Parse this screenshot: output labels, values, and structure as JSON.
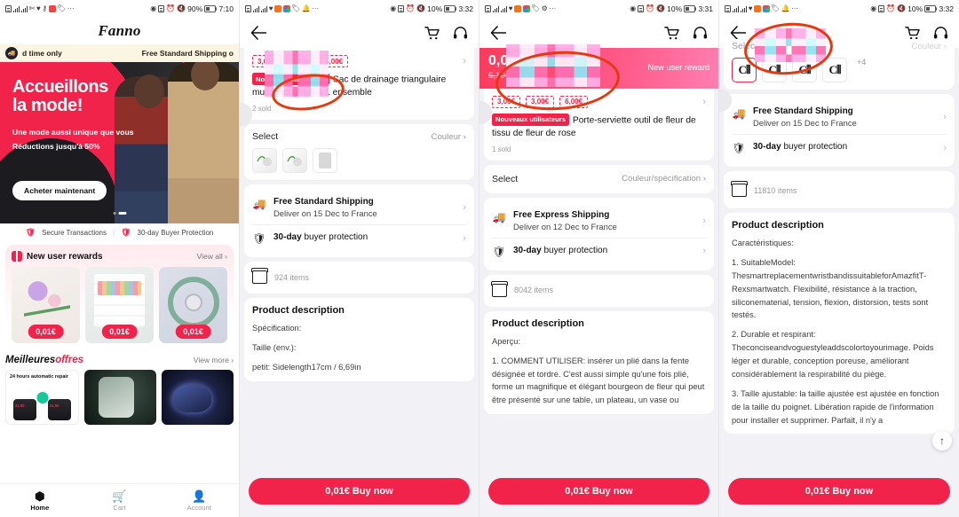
{
  "panel1": {
    "status": {
      "battery": "90%",
      "time": "7:10"
    },
    "brand": "Fanno",
    "promo": {
      "left": "d time only",
      "right": "Free Standard Shipping o"
    },
    "hero": {
      "title_line1": "Accueillons",
      "title_line2": "la mode!",
      "sub1": "Une mode aussi unique que vous",
      "sub2": "Réductions jusqu'à 50%",
      "cta": "Acheter maintenant"
    },
    "trust": {
      "left": "Secure Transactions",
      "divider": "|",
      "right": "30-day Buyer Protection"
    },
    "rewards": {
      "title": "New user rewards",
      "view_all": "View all",
      "cards": [
        {
          "price": "0,01€"
        },
        {
          "price": "0,01€"
        },
        {
          "price": "0,01€"
        }
      ]
    },
    "offers": {
      "title_black": "Meilleures",
      "title_red": "offres",
      "view_more": "View more",
      "card1_title": "24 hours automatic repair"
    },
    "tabs": [
      {
        "label": "Home",
        "icon": "home-icon"
      },
      {
        "label": "Cart",
        "icon": "cart-icon"
      },
      {
        "label": "Account",
        "icon": "account-icon"
      }
    ]
  },
  "panel2": {
    "status": {
      "battery": "10%",
      "time": "3:32"
    },
    "nav": {
      "back": "back-arrow-icon",
      "cart": "cart-icon",
      "support": "headset-icon"
    },
    "coupons": [
      "3,00€",
      "3,00€",
      "6,00€"
    ],
    "badge": "Nouveaux utilisateurs",
    "title": "Sac de drainage triangulaire multifonctionnel à 1 ensemble",
    "sold": "2 sold",
    "select": {
      "label": "Select",
      "value": "Couleur"
    },
    "shipping": {
      "title": "Free Standard Shipping",
      "sub": "Deliver on 15 Dec to France"
    },
    "protection": {
      "strong": "30-day",
      "rest": " buyer protection"
    },
    "shop_items": "924 items",
    "desc_heading": "Product description",
    "desc_lines": [
      "Spécification:",
      "Taille (env.):",
      "petit: Sidelength17cm / 6,69in"
    ],
    "buy": "0,01€ Buy now"
  },
  "panel3": {
    "status": {
      "battery": "10%",
      "time": "3:31"
    },
    "banner": {
      "price": "0,01€",
      "old_price": "5,10€",
      "tag": "New user reward"
    },
    "coupons": [
      "3,00€",
      "3,00€",
      "6,00€"
    ],
    "badge": "Nouveaux utilisateurs",
    "title": "Porte-serviette outil de fleur de tissu de fleur de rose",
    "sold": "1 sold",
    "select": {
      "label": "Select",
      "value": "Couleur/spécification"
    },
    "shipping": {
      "title": "Free Express Shipping",
      "sub": "Deliver on 12 Dec to France"
    },
    "protection": {
      "strong": "30-day",
      "rest": " buyer protection"
    },
    "shop_items": "8042 items",
    "desc_heading": "Product description",
    "desc_lines": [
      "Aperçu:",
      "1. COMMENT UTILISER: insérer un plié dans la fente désignée et tordre. C'est aussi simple qu'une fois plié, forme un magnifique et élégant bourgeon de fleur qui peut être présenté sur une table, un plateau, un vase ou"
    ],
    "buy": "0,01€ Buy now"
  },
  "panel4": {
    "status": {
      "battery": "10%",
      "time": "3:32"
    },
    "select": {
      "label": "Select",
      "value": "Couleur"
    },
    "swatch_more": "+4",
    "shipping": {
      "title": "Free Standard Shipping",
      "sub": "Deliver on 15 Dec to France"
    },
    "protection": {
      "strong": "30-day",
      "rest": " buyer protection"
    },
    "shop_items": "11810 items",
    "desc_heading": "Product description",
    "desc_lines": [
      "Caractéristiques:",
      "1. SuitableModel: ThesmartreplacementwristbandissuitableforAmazfitT-Rexsmartwatch. Flexibilité, résistance à la traction, siliconematerial, tension, flexion, distorsion, tests sont testés.",
      "2. Durable et respirant: Theconciseandvoguestyleaddscolortoyourimage. Poids léger et durable, conception poreuse, améliorant considérablement la respirabilité du piège.",
      "3. Taille ajustable: la taille ajustée est ajustée en fonction de la taille du poignet. Libération rapide de l'information pour installer et supprimer. Parfait, il n'y a"
    ],
    "scroll_top": "scroll-top-icon",
    "buy": "0,01€ Buy now"
  },
  "colors": {
    "accent": "#f2234b",
    "banner": "#fb3b5c",
    "annotation": "#e8380d",
    "promo_bg": "#fbf5e4"
  }
}
